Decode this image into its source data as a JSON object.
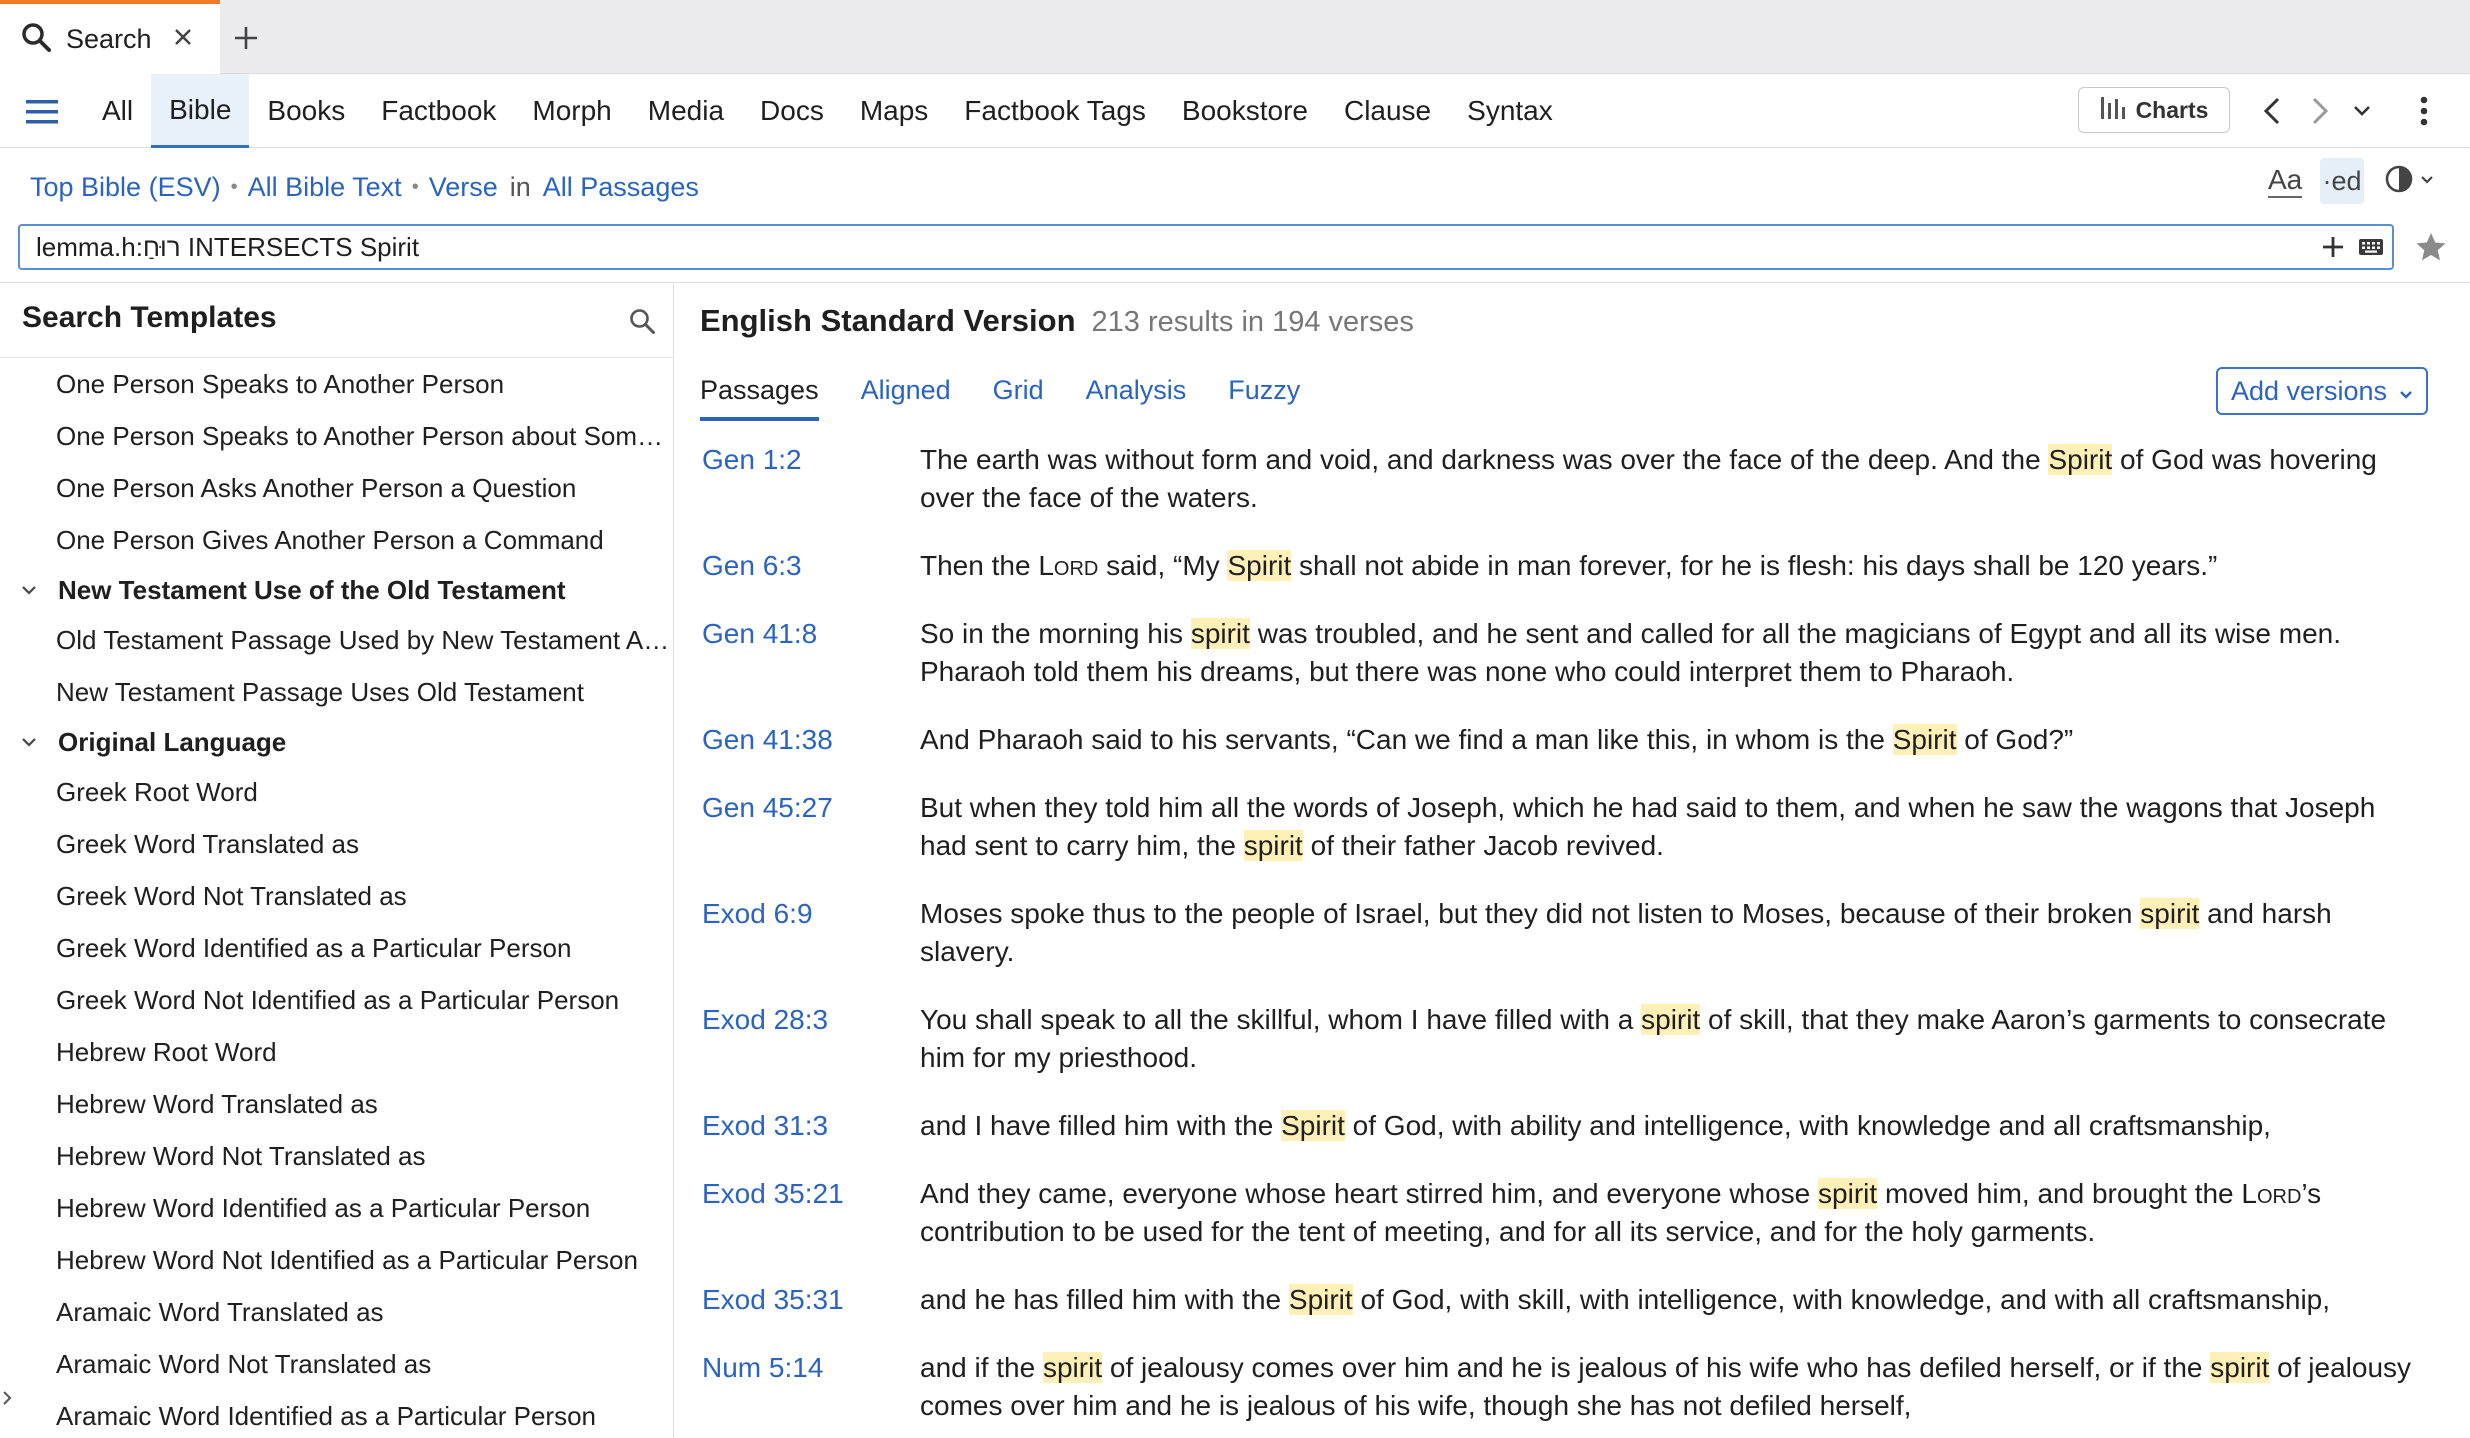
{
  "tab": {
    "label": "Search",
    "icon": "search-icon"
  },
  "nav": {
    "tabs": [
      {
        "label": "All",
        "active": false
      },
      {
        "label": "Bible",
        "active": true
      },
      {
        "label": "Books",
        "active": false
      },
      {
        "label": "Factbook",
        "active": false
      },
      {
        "label": "Morph",
        "active": false
      },
      {
        "label": "Media",
        "active": false
      },
      {
        "label": "Docs",
        "active": false
      },
      {
        "label": "Maps",
        "active": false
      },
      {
        "label": "Factbook Tags",
        "active": false
      },
      {
        "label": "Bookstore",
        "active": false
      },
      {
        "label": "Clause",
        "active": false
      },
      {
        "label": "Syntax",
        "active": false
      }
    ],
    "charts_label": "Charts"
  },
  "scope": {
    "bible": "Top Bible (ESV)",
    "text": "All Bible Text",
    "unit": "Verse",
    "in_label": "in",
    "range": "All Passages",
    "font_label": "Aa",
    "ed_label": "·ed"
  },
  "search": {
    "query": "lemma.h:רוּחַ INTERSECTS Spirit"
  },
  "templates": {
    "title": "Search Templates",
    "rows": [
      {
        "kind": "item",
        "label": "One Person Speaks to Another Person"
      },
      {
        "kind": "item",
        "label": "One Person Speaks to Another Person about Som…"
      },
      {
        "kind": "item",
        "label": "One Person Asks Another Person a Question"
      },
      {
        "kind": "item",
        "label": "One Person Gives Another Person a Command"
      },
      {
        "kind": "group",
        "label": "New Testament Use of the Old Testament"
      },
      {
        "kind": "item",
        "label": "Old Testament Passage Used by New Testament A…"
      },
      {
        "kind": "item",
        "label": "New Testament Passage Uses Old Testament"
      },
      {
        "kind": "group",
        "label": "Original Language"
      },
      {
        "kind": "item",
        "label": "Greek Root Word"
      },
      {
        "kind": "item",
        "label": "Greek Word Translated as"
      },
      {
        "kind": "item",
        "label": "Greek Word Not Translated as"
      },
      {
        "kind": "item",
        "label": "Greek Word Identified as a Particular Person"
      },
      {
        "kind": "item",
        "label": "Greek Word Not Identified as a Particular Person"
      },
      {
        "kind": "item",
        "label": "Hebrew Root Word"
      },
      {
        "kind": "item",
        "label": "Hebrew Word Translated as"
      },
      {
        "kind": "item",
        "label": "Hebrew Word Not Translated as"
      },
      {
        "kind": "item",
        "label": "Hebrew Word Identified as a Particular Person"
      },
      {
        "kind": "item",
        "label": "Hebrew Word Not Identified as a Particular Person"
      },
      {
        "kind": "item",
        "label": "Aramaic Word Translated as"
      },
      {
        "kind": "item",
        "label": "Aramaic Word Not Translated as"
      },
      {
        "kind": "item",
        "label": "Aramaic Word Identified as a Particular Person"
      }
    ]
  },
  "results": {
    "version": "English Standard Version",
    "summary": "213 results in 194 verses",
    "tabs": [
      {
        "label": "Passages",
        "active": true
      },
      {
        "label": "Aligned",
        "active": false
      },
      {
        "label": "Grid",
        "active": false
      },
      {
        "label": "Analysis",
        "active": false
      },
      {
        "label": "Fuzzy",
        "active": false
      }
    ],
    "add_versions": "Add versions",
    "highlight_color": "#fff0b8",
    "link_color": "#2a64c0",
    "verses": [
      {
        "ref": "Gen 1:2",
        "segments": [
          {
            "t": "The earth was without form and void, and darkness was over the face of the deep. And the "
          },
          {
            "t": "Spirit",
            "hl": true
          },
          {
            "t": " of God was hovering over the face of the waters."
          }
        ]
      },
      {
        "ref": "Gen 6:3",
        "segments": [
          {
            "t": "Then the "
          },
          {
            "t": "Lord",
            "sc": true
          },
          {
            "t": " said, “My "
          },
          {
            "t": "Spirit",
            "hl": true
          },
          {
            "t": " shall not abide in man forever, for he is flesh: his days shall be 120 years.”"
          }
        ]
      },
      {
        "ref": "Gen 41:8",
        "segments": [
          {
            "t": "So in the morning his "
          },
          {
            "t": "spirit",
            "hl": true
          },
          {
            "t": " was troubled, and he sent and called for all the magicians of Egypt and all its wise men. Pharaoh told them his dreams, but there was none who could interpret them to Pharaoh."
          }
        ]
      },
      {
        "ref": "Gen 41:38",
        "segments": [
          {
            "t": "And Pharaoh said to his servants, “Can we find a man like this, in whom is the "
          },
          {
            "t": "Spirit",
            "hl": true
          },
          {
            "t": " of God?”"
          }
        ]
      },
      {
        "ref": "Gen 45:27",
        "segments": [
          {
            "t": "But when they told him all the words of Joseph, which he had said to them, and when he saw the wagons that Joseph had sent to carry him, the "
          },
          {
            "t": "spirit",
            "hl": true
          },
          {
            "t": " of their father Jacob revived."
          }
        ]
      },
      {
        "ref": "Exod 6:9",
        "segments": [
          {
            "t": "Moses spoke thus to the people of Israel, but they did not listen to Moses, because of their broken "
          },
          {
            "t": "spirit",
            "hl": true
          },
          {
            "t": " and harsh slavery."
          }
        ]
      },
      {
        "ref": "Exod 28:3",
        "segments": [
          {
            "t": "You shall speak to all the skillful, whom I have filled with a "
          },
          {
            "t": "spirit",
            "hl": true
          },
          {
            "t": " of skill, that they make Aaron’s garments to consecrate him for my priesthood."
          }
        ]
      },
      {
        "ref": "Exod 31:3",
        "segments": [
          {
            "t": "and I have filled him with the "
          },
          {
            "t": "Spirit",
            "hl": true
          },
          {
            "t": " of God, with ability and intelligence, with knowledge and all craftsmanship,"
          }
        ]
      },
      {
        "ref": "Exod 35:21",
        "segments": [
          {
            "t": "And they came, everyone whose heart stirred him, and everyone whose "
          },
          {
            "t": "spirit",
            "hl": true
          },
          {
            "t": " moved him, and brought the "
          },
          {
            "t": "Lord",
            "sc": true
          },
          {
            "t": "’s contribution to be used for the tent of meeting, and for all its service, and for the holy garments."
          }
        ]
      },
      {
        "ref": "Exod 35:31",
        "segments": [
          {
            "t": "and he has filled him with the "
          },
          {
            "t": "Spirit",
            "hl": true
          },
          {
            "t": " of God, with skill, with intelligence, with knowledge, and with all craftsmanship,"
          }
        ]
      },
      {
        "ref": "Num 5:14",
        "segments": [
          {
            "t": "and if the "
          },
          {
            "t": "spirit",
            "hl": true
          },
          {
            "t": " of jealousy comes over him and he is jealous of his wife who has defiled herself, or if the "
          },
          {
            "t": "spirit",
            "hl": true
          },
          {
            "t": " of jealousy comes over him and he is jealous of his wife, though she has not defiled herself,"
          }
        ]
      }
    ]
  }
}
